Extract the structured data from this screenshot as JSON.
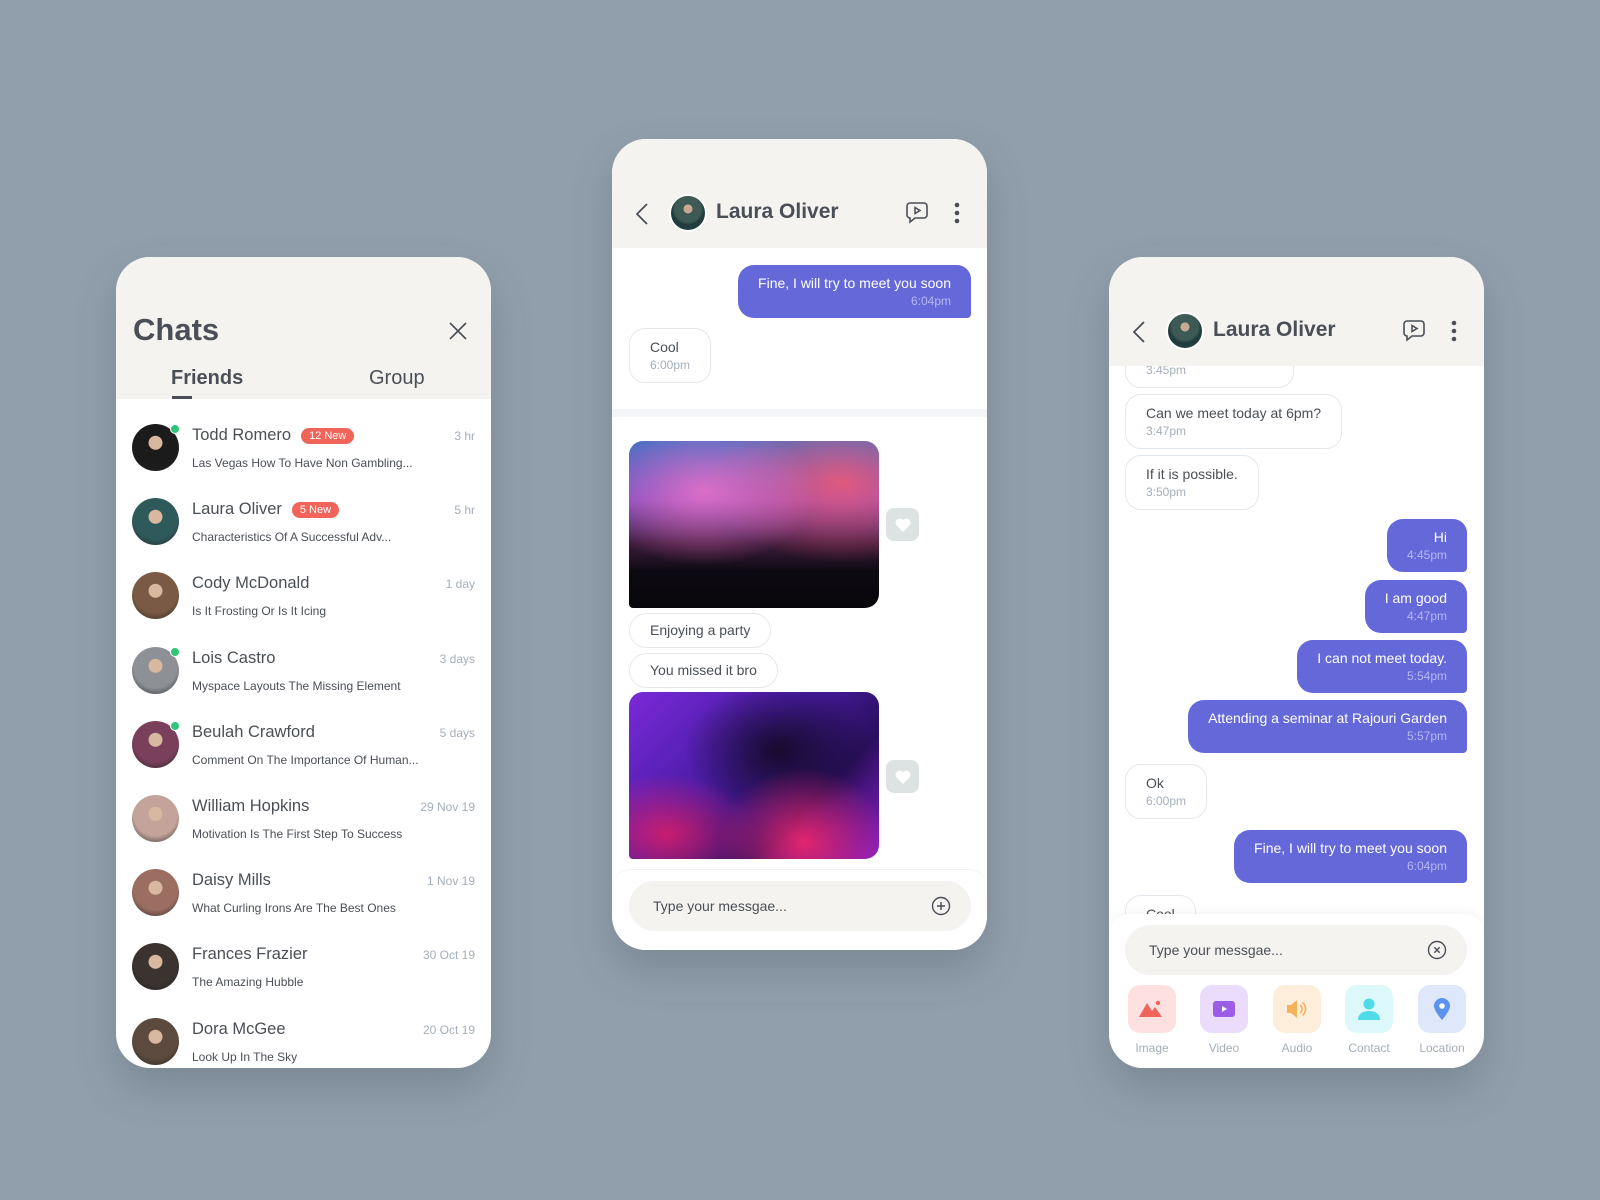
{
  "chats_panel": {
    "title": "Chats",
    "tabs": [
      {
        "label": "Friends",
        "active": true
      },
      {
        "label": "Group",
        "active": false
      }
    ],
    "items": [
      {
        "name": "Todd Romero",
        "badge": "12 New",
        "time": "3 hr",
        "preview": "Las Vegas How To Have Non Gambling...",
        "online": true,
        "avatar_color": "#1b1b1b"
      },
      {
        "name": "Laura Oliver",
        "badge": "5 New",
        "time": "5 hr",
        "preview": "Characteristics Of A Successful Adv...",
        "online": false,
        "avatar_color": "#2f5a5c"
      },
      {
        "name": "Cody McDonald",
        "badge": "",
        "time": "1 day",
        "preview": "Is It Frosting Or Is It Icing",
        "online": false,
        "avatar_color": "#7a5a44"
      },
      {
        "name": "Lois Castro",
        "badge": "",
        "time": "3 days",
        "preview": "Myspace Layouts The Missing Element",
        "online": true,
        "avatar_color": "#8d9196"
      },
      {
        "name": "Beulah Crawford",
        "badge": "",
        "time": "5 days",
        "preview": "Comment On The Importance Of Human...",
        "online": true,
        "avatar_color": "#7a3f5a"
      },
      {
        "name": "William Hopkins",
        "badge": "",
        "time": "29 Nov 19",
        "preview": "Motivation Is The First Step To Success",
        "online": false,
        "avatar_color": "#c4a39a"
      },
      {
        "name": "Daisy Mills",
        "badge": "",
        "time": "1 Nov 19",
        "preview": "What Curling Irons Are The Best Ones",
        "online": false,
        "avatar_color": "#9c6e62"
      },
      {
        "name": "Frances Frazier",
        "badge": "",
        "time": "30 Oct 19",
        "preview": "The Amazing Hubble",
        "online": false,
        "avatar_color": "#3a3330"
      },
      {
        "name": "Dora McGee",
        "badge": "",
        "time": "20 Oct 19",
        "preview": "Look Up In The Sky",
        "online": false,
        "avatar_color": "#5d4a3e"
      }
    ]
  },
  "conversation_middle": {
    "contact_name": "Laura Oliver",
    "messages": [
      {
        "type": "sent",
        "text": "Fine, I will try to meet you soon",
        "time": "6:04pm"
      },
      {
        "type": "received",
        "text": "Cool",
        "time": "6:00pm"
      }
    ],
    "media_messages": [
      {
        "image": "concert-crowd-photo",
        "caption": "Enjoying a party"
      },
      {
        "caption": "You missed it bro",
        "image": "dj-mixer-photo"
      }
    ],
    "input_placeholder": "Type your messgae..."
  },
  "conversation_right": {
    "contact_name": "Laura Oliver",
    "messages": [
      {
        "type": "received",
        "text": "",
        "time": "3:45pm"
      },
      {
        "type": "received",
        "text": "Can we meet today at 6pm?",
        "time": "3:47pm"
      },
      {
        "type": "received",
        "text": "If it is possible.",
        "time": "3:50pm"
      },
      {
        "type": "sent",
        "text": "Hi",
        "time": "4:45pm"
      },
      {
        "type": "sent",
        "text": "I am good",
        "time": "4:47pm"
      },
      {
        "type": "sent",
        "text": "I can not meet today.",
        "time": "5:54pm"
      },
      {
        "type": "sent",
        "text": "Attending a seminar at Rajouri Garden",
        "time": "5:57pm"
      },
      {
        "type": "received",
        "text": "Ok",
        "time": "6:00pm"
      },
      {
        "type": "sent",
        "text": "Fine, I will try to meet you soon",
        "time": "6:04pm"
      },
      {
        "type": "received",
        "text": "Cool",
        "time": ""
      }
    ],
    "input_placeholder": "Type your messgae...",
    "attachments": [
      {
        "label": "Image",
        "icon": "image-icon",
        "color": "#f0645a",
        "bg": "#fde0df"
      },
      {
        "label": "Video",
        "icon": "video-icon",
        "color": "#9b5de5",
        "bg": "#ecdcfb"
      },
      {
        "label": "Audio",
        "icon": "audio-icon",
        "color": "#f4b25a",
        "bg": "#fdeedb"
      },
      {
        "label": "Contact",
        "icon": "contact-icon",
        "color": "#4fdbe8",
        "bg": "#dcf8fb"
      },
      {
        "label": "Location",
        "icon": "location-icon",
        "color": "#5b93f0",
        "bg": "#dfe8fb"
      }
    ]
  },
  "colors": {
    "background": "#919fac",
    "accent": "#6568d8",
    "badge": "#f0645a",
    "online": "#2fc57b",
    "header": "#f4f3f0"
  }
}
